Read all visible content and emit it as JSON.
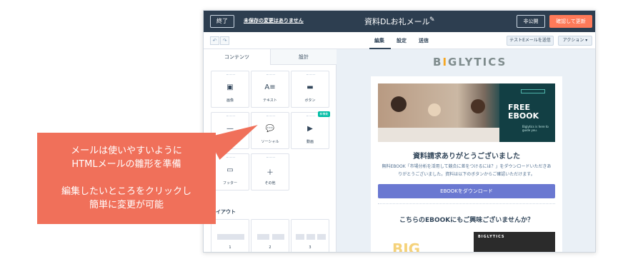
{
  "topbar": {
    "exit_label": "終了",
    "unsaved_text": "未保存の変更はありません",
    "title": "資料DLお礼メール",
    "private_label": "非公開",
    "confirm_label": "確認して更新"
  },
  "subbar": {
    "undo_glyph": "↶",
    "redo_glyph": "↷",
    "tabs": [
      "編集",
      "設定",
      "送信"
    ],
    "test_email_label": "テストEメールを送信",
    "action_label": "アクション ▾"
  },
  "sidebar": {
    "tabs": [
      "コンテンツ",
      "設計"
    ],
    "tiles": [
      {
        "label": "画像",
        "icon": "image-icon"
      },
      {
        "label": "テキスト",
        "icon": "text-icon"
      },
      {
        "label": "ボタン",
        "icon": "button-icon"
      },
      {
        "label": "区切り",
        "icon": "divider-icon"
      },
      {
        "label": "ソーシャル",
        "icon": "social-icon"
      },
      {
        "label": "動画",
        "icon": "video-icon",
        "badge": "新機能"
      },
      {
        "label": "フッター",
        "icon": "footer-icon"
      },
      {
        "label": "その他",
        "icon": "plus-icon"
      }
    ],
    "section_label": "レイアウト",
    "layouts": [
      "1",
      "2",
      "3"
    ]
  },
  "preview": {
    "logo": "BIGLYTICS",
    "hero_title": "FREE EBOOK",
    "hero_small": "Biglytics is here to guide you.",
    "thanks_heading": "資料請求ありがとうございました",
    "body_text": "無料EBOOK「市場分析を活用して競合に差をつけるには？」をダウンロードいただきありがとうございました。資料は以下のボタンからご確認いただけます。",
    "download_button": "EBOOKをダウンロード",
    "question_heading": "こちらのEBOOKにもご興味ございませんか？",
    "thumb_logo": "BIGLYTICS",
    "thumb_big": "BIG"
  },
  "callout": {
    "line1": "メールは使いやすいように",
    "line2": "HTMLメールの雛形を準備",
    "line3": "編集したいところをクリックし",
    "line4": "簡単に変更が可能"
  },
  "colors": {
    "topbar": "#2d3e50",
    "accent_orange": "#ff7a59",
    "callout": "#f0705a",
    "button_purple": "#6a78d1",
    "badge_teal": "#00bda5"
  }
}
